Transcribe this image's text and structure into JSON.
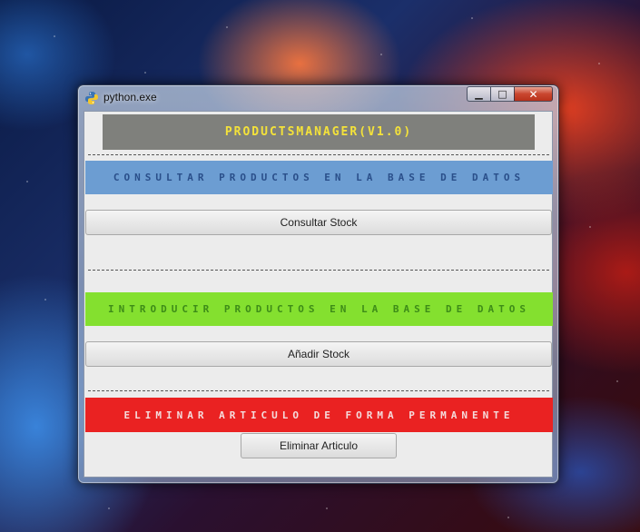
{
  "window": {
    "title": "python.exe",
    "controls": {
      "minimize": "▁",
      "maximize": "□",
      "close": "✕"
    }
  },
  "app": {
    "header": "ProductsManager(v1.0)",
    "sections": {
      "consultar": {
        "heading": "Consultar productos en la base de datos",
        "button": "Consultar Stock",
        "color": "#6c9dd2"
      },
      "introducir": {
        "heading": "Introducir productos en la base de datos",
        "button": "Añadir Stock",
        "color": "#84e02f"
      },
      "eliminar": {
        "heading": "Eliminar articulo de forma permanente",
        "button": "Eliminar Articulo",
        "color": "#ea2222"
      }
    },
    "header_text_color": "#f4e23a"
  },
  "icons": {
    "app": "python-icon"
  }
}
